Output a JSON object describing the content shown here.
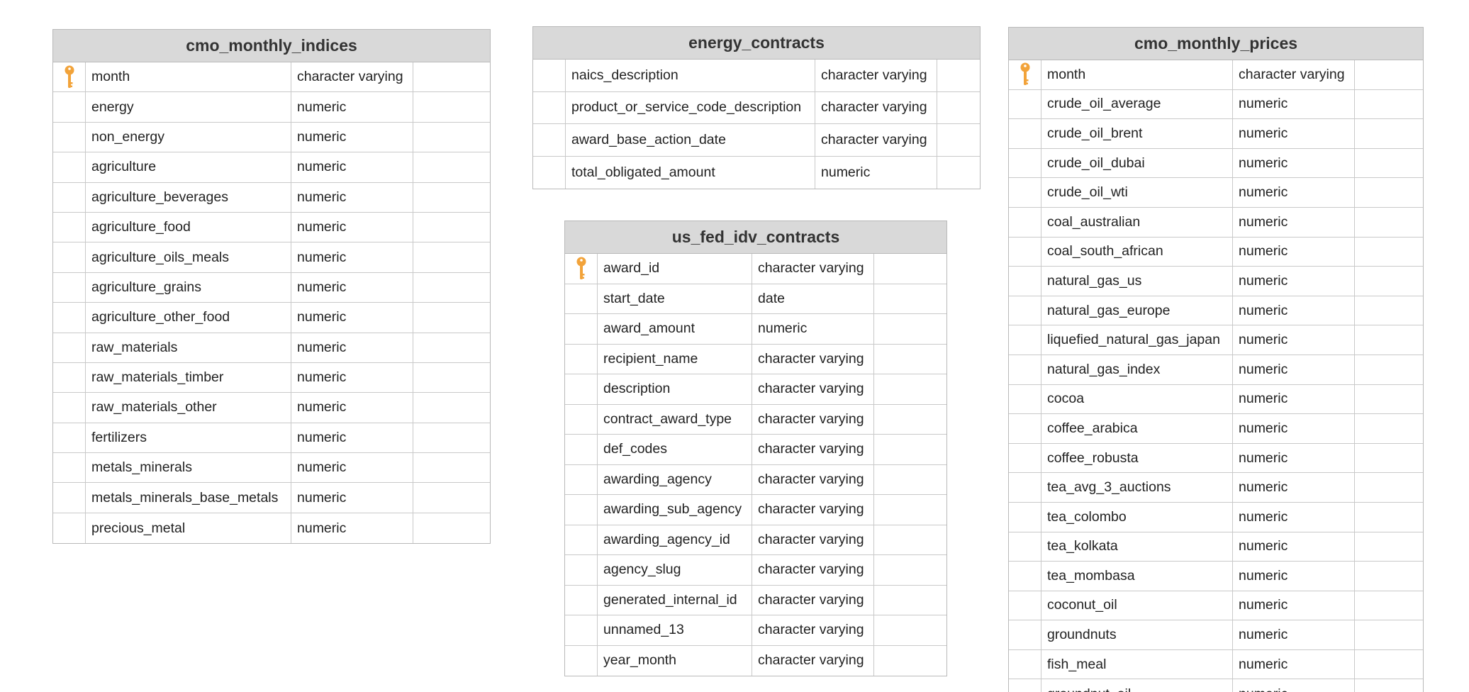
{
  "colors": {
    "header_bg": "#d9d9d9",
    "border": "#b9b9b9",
    "key": "#f2a33a"
  },
  "tables": [
    {
      "id": "cmo-monthly-indices",
      "title": "cmo_monthly_indices",
      "columns": [
        {
          "name": "month",
          "type": "character varying",
          "pk": true
        },
        {
          "name": "energy",
          "type": "numeric"
        },
        {
          "name": "non_energy",
          "type": "numeric"
        },
        {
          "name": "agriculture",
          "type": "numeric"
        },
        {
          "name": "agriculture_beverages",
          "type": "numeric"
        },
        {
          "name": "agriculture_food",
          "type": "numeric"
        },
        {
          "name": "agriculture_oils_meals",
          "type": "numeric"
        },
        {
          "name": "agriculture_grains",
          "type": "numeric"
        },
        {
          "name": "agriculture_other_food",
          "type": "numeric"
        },
        {
          "name": "raw_materials",
          "type": "numeric"
        },
        {
          "name": "raw_materials_timber",
          "type": "numeric"
        },
        {
          "name": "raw_materials_other",
          "type": "numeric"
        },
        {
          "name": "fertilizers",
          "type": "numeric"
        },
        {
          "name": "metals_minerals",
          "type": "numeric"
        },
        {
          "name": "metals_minerals_base_metals",
          "type": "numeric"
        },
        {
          "name": "precious_metal",
          "type": "numeric"
        }
      ]
    },
    {
      "id": "energy-contracts",
      "title": "energy_contracts",
      "columns": [
        {
          "name": "naics_description",
          "type": "character varying"
        },
        {
          "name": "product_or_service_code_description",
          "type": "character varying"
        },
        {
          "name": "award_base_action_date",
          "type": "character varying"
        },
        {
          "name": "total_obligated_amount",
          "type": "numeric"
        }
      ]
    },
    {
      "id": "us-fed-idv-contracts",
      "title": "us_fed_idv_contracts",
      "columns": [
        {
          "name": "award_id",
          "type": "character varying",
          "pk": true
        },
        {
          "name": "start_date",
          "type": "date"
        },
        {
          "name": "award_amount",
          "type": "numeric"
        },
        {
          "name": "recipient_name",
          "type": "character varying"
        },
        {
          "name": "description",
          "type": "character varying"
        },
        {
          "name": "contract_award_type",
          "type": "character varying"
        },
        {
          "name": "def_codes",
          "type": "character varying"
        },
        {
          "name": "awarding_agency",
          "type": "character varying"
        },
        {
          "name": "awarding_sub_agency",
          "type": "character varying"
        },
        {
          "name": "awarding_agency_id",
          "type": "character varying"
        },
        {
          "name": "agency_slug",
          "type": "character varying"
        },
        {
          "name": "generated_internal_id",
          "type": "character varying"
        },
        {
          "name": "unnamed_13",
          "type": "character varying"
        },
        {
          "name": "year_month",
          "type": "character varying"
        }
      ]
    },
    {
      "id": "cmo-monthly-prices",
      "title": "cmo_monthly_prices",
      "columns": [
        {
          "name": "month",
          "type": "character varying",
          "pk": true
        },
        {
          "name": "crude_oil_average",
          "type": "numeric"
        },
        {
          "name": "crude_oil_brent",
          "type": "numeric"
        },
        {
          "name": "crude_oil_dubai",
          "type": "numeric"
        },
        {
          "name": "crude_oil_wti",
          "type": "numeric"
        },
        {
          "name": "coal_australian",
          "type": "numeric"
        },
        {
          "name": "coal_south_african",
          "type": "numeric"
        },
        {
          "name": "natural_gas_us",
          "type": "numeric"
        },
        {
          "name": "natural_gas_europe",
          "type": "numeric"
        },
        {
          "name": "liquefied_natural_gas_japan",
          "type": "numeric"
        },
        {
          "name": "natural_gas_index",
          "type": "numeric"
        },
        {
          "name": "cocoa",
          "type": "numeric"
        },
        {
          "name": "coffee_arabica",
          "type": "numeric"
        },
        {
          "name": "coffee_robusta",
          "type": "numeric"
        },
        {
          "name": "tea_avg_3_auctions",
          "type": "numeric"
        },
        {
          "name": "tea_colombo",
          "type": "numeric"
        },
        {
          "name": "tea_kolkata",
          "type": "numeric"
        },
        {
          "name": "tea_mombasa",
          "type": "numeric"
        },
        {
          "name": "coconut_oil",
          "type": "numeric"
        },
        {
          "name": "groundnuts",
          "type": "numeric"
        },
        {
          "name": "fish_meal",
          "type": "numeric"
        },
        {
          "name": "groundnut_oil",
          "type": "numeric"
        }
      ]
    }
  ]
}
